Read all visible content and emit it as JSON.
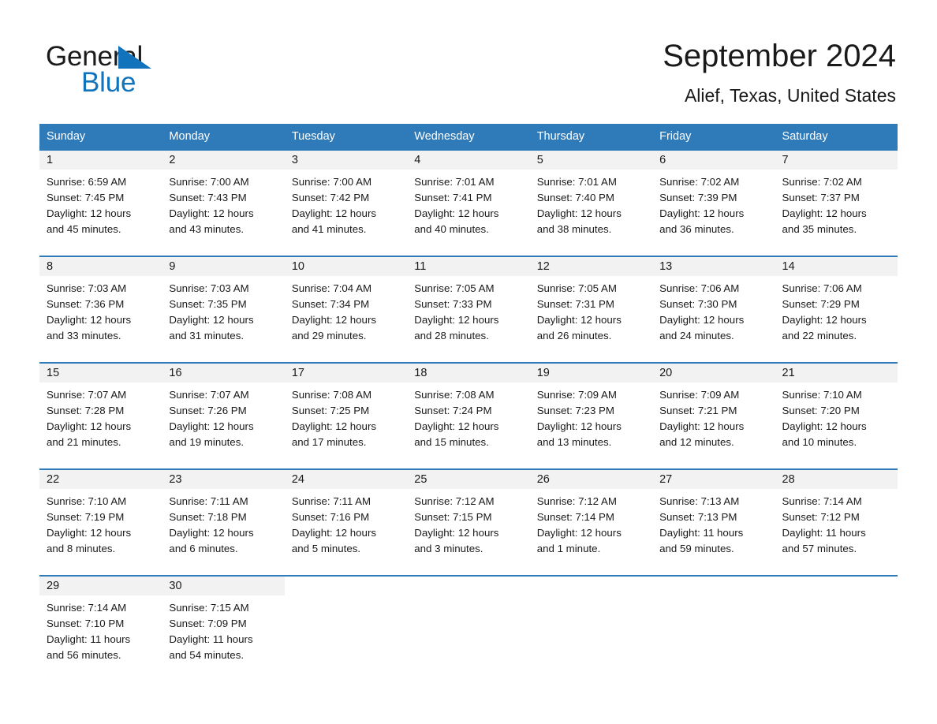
{
  "brand": {
    "name_part1": "General",
    "name_part2": "Blue",
    "triangle_color": "#1273bd",
    "text_color": "#1a1a1a"
  },
  "header": {
    "title": "September 2024",
    "subtitle": "Alief, Texas, United States"
  },
  "theme": {
    "header_blue": "#2f7ab9",
    "daynum_band": "#f2f2f2",
    "text": "#1a1a1a",
    "white": "#ffffff"
  },
  "calendar": {
    "day_headers": [
      "Sunday",
      "Monday",
      "Tuesday",
      "Wednesday",
      "Thursday",
      "Friday",
      "Saturday"
    ],
    "weeks": [
      [
        {
          "day": "1",
          "sunrise": "Sunrise: 6:59 AM",
          "sunset": "Sunset: 7:45 PM",
          "daylight_1": "Daylight: 12 hours",
          "daylight_2": "and 45 minutes."
        },
        {
          "day": "2",
          "sunrise": "Sunrise: 7:00 AM",
          "sunset": "Sunset: 7:43 PM",
          "daylight_1": "Daylight: 12 hours",
          "daylight_2": "and 43 minutes."
        },
        {
          "day": "3",
          "sunrise": "Sunrise: 7:00 AM",
          "sunset": "Sunset: 7:42 PM",
          "daylight_1": "Daylight: 12 hours",
          "daylight_2": "and 41 minutes."
        },
        {
          "day": "4",
          "sunrise": "Sunrise: 7:01 AM",
          "sunset": "Sunset: 7:41 PM",
          "daylight_1": "Daylight: 12 hours",
          "daylight_2": "and 40 minutes."
        },
        {
          "day": "5",
          "sunrise": "Sunrise: 7:01 AM",
          "sunset": "Sunset: 7:40 PM",
          "daylight_1": "Daylight: 12 hours",
          "daylight_2": "and 38 minutes."
        },
        {
          "day": "6",
          "sunrise": "Sunrise: 7:02 AM",
          "sunset": "Sunset: 7:39 PM",
          "daylight_1": "Daylight: 12 hours",
          "daylight_2": "and 36 minutes."
        },
        {
          "day": "7",
          "sunrise": "Sunrise: 7:02 AM",
          "sunset": "Sunset: 7:37 PM",
          "daylight_1": "Daylight: 12 hours",
          "daylight_2": "and 35 minutes."
        }
      ],
      [
        {
          "day": "8",
          "sunrise": "Sunrise: 7:03 AM",
          "sunset": "Sunset: 7:36 PM",
          "daylight_1": "Daylight: 12 hours",
          "daylight_2": "and 33 minutes."
        },
        {
          "day": "9",
          "sunrise": "Sunrise: 7:03 AM",
          "sunset": "Sunset: 7:35 PM",
          "daylight_1": "Daylight: 12 hours",
          "daylight_2": "and 31 minutes."
        },
        {
          "day": "10",
          "sunrise": "Sunrise: 7:04 AM",
          "sunset": "Sunset: 7:34 PM",
          "daylight_1": "Daylight: 12 hours",
          "daylight_2": "and 29 minutes."
        },
        {
          "day": "11",
          "sunrise": "Sunrise: 7:05 AM",
          "sunset": "Sunset: 7:33 PM",
          "daylight_1": "Daylight: 12 hours",
          "daylight_2": "and 28 minutes."
        },
        {
          "day": "12",
          "sunrise": "Sunrise: 7:05 AM",
          "sunset": "Sunset: 7:31 PM",
          "daylight_1": "Daylight: 12 hours",
          "daylight_2": "and 26 minutes."
        },
        {
          "day": "13",
          "sunrise": "Sunrise: 7:06 AM",
          "sunset": "Sunset: 7:30 PM",
          "daylight_1": "Daylight: 12 hours",
          "daylight_2": "and 24 minutes."
        },
        {
          "day": "14",
          "sunrise": "Sunrise: 7:06 AM",
          "sunset": "Sunset: 7:29 PM",
          "daylight_1": "Daylight: 12 hours",
          "daylight_2": "and 22 minutes."
        }
      ],
      [
        {
          "day": "15",
          "sunrise": "Sunrise: 7:07 AM",
          "sunset": "Sunset: 7:28 PM",
          "daylight_1": "Daylight: 12 hours",
          "daylight_2": "and 21 minutes."
        },
        {
          "day": "16",
          "sunrise": "Sunrise: 7:07 AM",
          "sunset": "Sunset: 7:26 PM",
          "daylight_1": "Daylight: 12 hours",
          "daylight_2": "and 19 minutes."
        },
        {
          "day": "17",
          "sunrise": "Sunrise: 7:08 AM",
          "sunset": "Sunset: 7:25 PM",
          "daylight_1": "Daylight: 12 hours",
          "daylight_2": "and 17 minutes."
        },
        {
          "day": "18",
          "sunrise": "Sunrise: 7:08 AM",
          "sunset": "Sunset: 7:24 PM",
          "daylight_1": "Daylight: 12 hours",
          "daylight_2": "and 15 minutes."
        },
        {
          "day": "19",
          "sunrise": "Sunrise: 7:09 AM",
          "sunset": "Sunset: 7:23 PM",
          "daylight_1": "Daylight: 12 hours",
          "daylight_2": "and 13 minutes."
        },
        {
          "day": "20",
          "sunrise": "Sunrise: 7:09 AM",
          "sunset": "Sunset: 7:21 PM",
          "daylight_1": "Daylight: 12 hours",
          "daylight_2": "and 12 minutes."
        },
        {
          "day": "21",
          "sunrise": "Sunrise: 7:10 AM",
          "sunset": "Sunset: 7:20 PM",
          "daylight_1": "Daylight: 12 hours",
          "daylight_2": "and 10 minutes."
        }
      ],
      [
        {
          "day": "22",
          "sunrise": "Sunrise: 7:10 AM",
          "sunset": "Sunset: 7:19 PM",
          "daylight_1": "Daylight: 12 hours",
          "daylight_2": "and 8 minutes."
        },
        {
          "day": "23",
          "sunrise": "Sunrise: 7:11 AM",
          "sunset": "Sunset: 7:18 PM",
          "daylight_1": "Daylight: 12 hours",
          "daylight_2": "and 6 minutes."
        },
        {
          "day": "24",
          "sunrise": "Sunrise: 7:11 AM",
          "sunset": "Sunset: 7:16 PM",
          "daylight_1": "Daylight: 12 hours",
          "daylight_2": "and 5 minutes."
        },
        {
          "day": "25",
          "sunrise": "Sunrise: 7:12 AM",
          "sunset": "Sunset: 7:15 PM",
          "daylight_1": "Daylight: 12 hours",
          "daylight_2": "and 3 minutes."
        },
        {
          "day": "26",
          "sunrise": "Sunrise: 7:12 AM",
          "sunset": "Sunset: 7:14 PM",
          "daylight_1": "Daylight: 12 hours",
          "daylight_2": "and 1 minute."
        },
        {
          "day": "27",
          "sunrise": "Sunrise: 7:13 AM",
          "sunset": "Sunset: 7:13 PM",
          "daylight_1": "Daylight: 11 hours",
          "daylight_2": "and 59 minutes."
        },
        {
          "day": "28",
          "sunrise": "Sunrise: 7:14 AM",
          "sunset": "Sunset: 7:12 PM",
          "daylight_1": "Daylight: 11 hours",
          "daylight_2": "and 57 minutes."
        }
      ],
      [
        {
          "day": "29",
          "sunrise": "Sunrise: 7:14 AM",
          "sunset": "Sunset: 7:10 PM",
          "daylight_1": "Daylight: 11 hours",
          "daylight_2": "and 56 minutes."
        },
        {
          "day": "30",
          "sunrise": "Sunrise: 7:15 AM",
          "sunset": "Sunset: 7:09 PM",
          "daylight_1": "Daylight: 11 hours",
          "daylight_2": "and 54 minutes."
        },
        {
          "day": "",
          "sunrise": "",
          "sunset": "",
          "daylight_1": "",
          "daylight_2": ""
        },
        {
          "day": "",
          "sunrise": "",
          "sunset": "",
          "daylight_1": "",
          "daylight_2": ""
        },
        {
          "day": "",
          "sunrise": "",
          "sunset": "",
          "daylight_1": "",
          "daylight_2": ""
        },
        {
          "day": "",
          "sunrise": "",
          "sunset": "",
          "daylight_1": "",
          "daylight_2": ""
        },
        {
          "day": "",
          "sunrise": "",
          "sunset": "",
          "daylight_1": "",
          "daylight_2": ""
        }
      ]
    ]
  }
}
